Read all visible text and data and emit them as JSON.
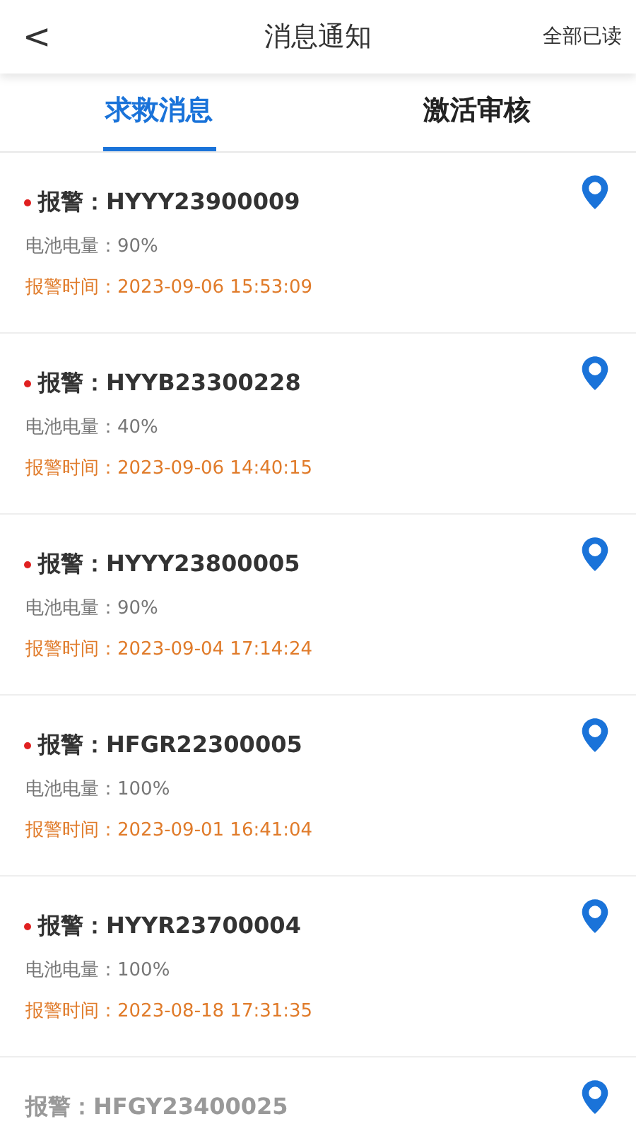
{
  "header": {
    "back": "<",
    "title": "消息通知",
    "action": "全部已读"
  },
  "tabs": [
    {
      "label": "求救消息",
      "selected": true
    },
    {
      "label": "激活审核",
      "selected": false
    }
  ],
  "messages": [
    {
      "title": "报警：HYYY23900009",
      "unread": true,
      "battery": "电池电量：90%",
      "time": "报警时间：2023-09-06 15:53:09"
    },
    {
      "title": "报警：HYYB23300228",
      "unread": true,
      "battery": "电池电量：40%",
      "time": "报警时间：2023-09-06 14:40:15"
    },
    {
      "title": "报警：HYYY23800005",
      "unread": true,
      "battery": "电池电量：90%",
      "time": "报警时间：2023-09-04 17:14:24"
    },
    {
      "title": "报警：HFGR22300005",
      "unread": true,
      "battery": "电池电量：100%",
      "time": "报警时间：2023-09-01 16:41:04"
    },
    {
      "title": "报警：HYYR23700004",
      "unread": true,
      "battery": "电池电量：100%",
      "time": "报警时间：2023-08-18 17:31:35"
    },
    {
      "title": "报警：HFGY23400025",
      "unread": false
    }
  ]
}
